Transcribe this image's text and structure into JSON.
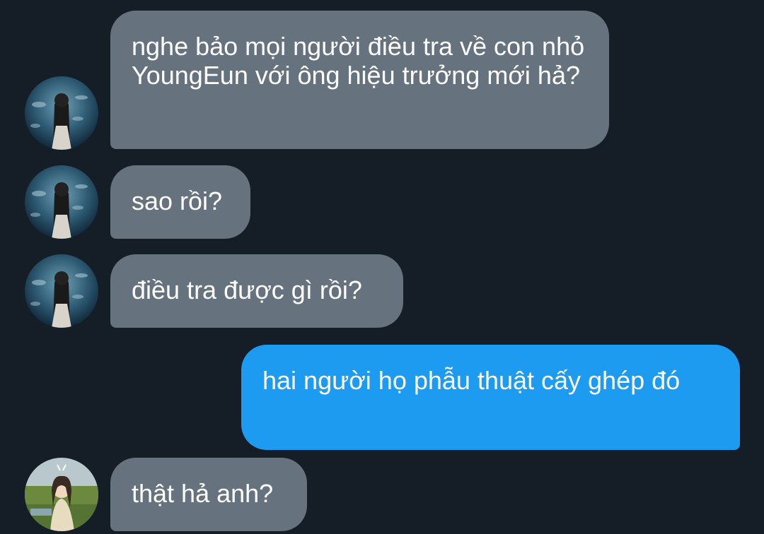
{
  "conversation": {
    "messages": [
      {
        "sender": "contact_a",
        "direction": "incoming",
        "text": "nghe bảo mọi người điều tra về con nhỏ YoungEun với ông hiệu trưởng mới hả?"
      },
      {
        "sender": "contact_a",
        "direction": "incoming",
        "text": "sao rồi?"
      },
      {
        "sender": "contact_a",
        "direction": "incoming",
        "text": "điều tra được gì rồi?"
      },
      {
        "sender": "me",
        "direction": "outgoing",
        "text": "hai người họ phẫu thuật cấy ghép đó"
      },
      {
        "sender": "contact_b",
        "direction": "incoming",
        "text": "thật hả anh?"
      }
    ]
  },
  "colors": {
    "background": "#151d26",
    "incoming_bubble": "#66737f",
    "outgoing_bubble": "#1d9bf0",
    "text": "#ffffff"
  },
  "icons": {
    "contact_a_avatar": "avatar-aquarium-girl",
    "contact_b_avatar": "avatar-field-girl"
  }
}
